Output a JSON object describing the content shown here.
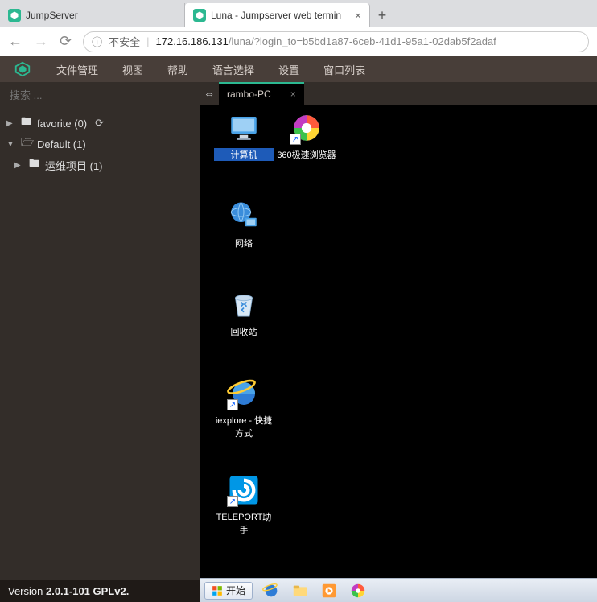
{
  "browser": {
    "tabs": [
      {
        "title": "JumpServer",
        "active": false
      },
      {
        "title": "Luna - Jumpserver web termin",
        "active": true
      }
    ],
    "insecure_label": "不安全",
    "url_host": "172.16.186.131",
    "url_path": "/luna/?login_to=b5bd1a87-6ceb-41d1-95a1-02dab5f2adaf"
  },
  "menu": {
    "items": [
      "文件管理",
      "视图",
      "帮助",
      "语言选择",
      "设置",
      "窗口列表"
    ]
  },
  "sidebar": {
    "search_placeholder": "搜索 ...",
    "tree": {
      "favorite": "favorite (0)",
      "default": "Default (1)",
      "project": "运维项目 (1)"
    }
  },
  "content_tab": {
    "title": "rambo-PC"
  },
  "desktop": {
    "icons": {
      "computer": "计算机",
      "chrome360": "360极速浏览器",
      "network": "网络",
      "recycle": "回收站",
      "ie": "iexplore - 快捷方式",
      "teleport": "TELEPORT助手"
    }
  },
  "taskbar": {
    "start": "开始"
  },
  "footer": {
    "prefix": "Version ",
    "version": "2.0.1-101 GPLv2."
  }
}
